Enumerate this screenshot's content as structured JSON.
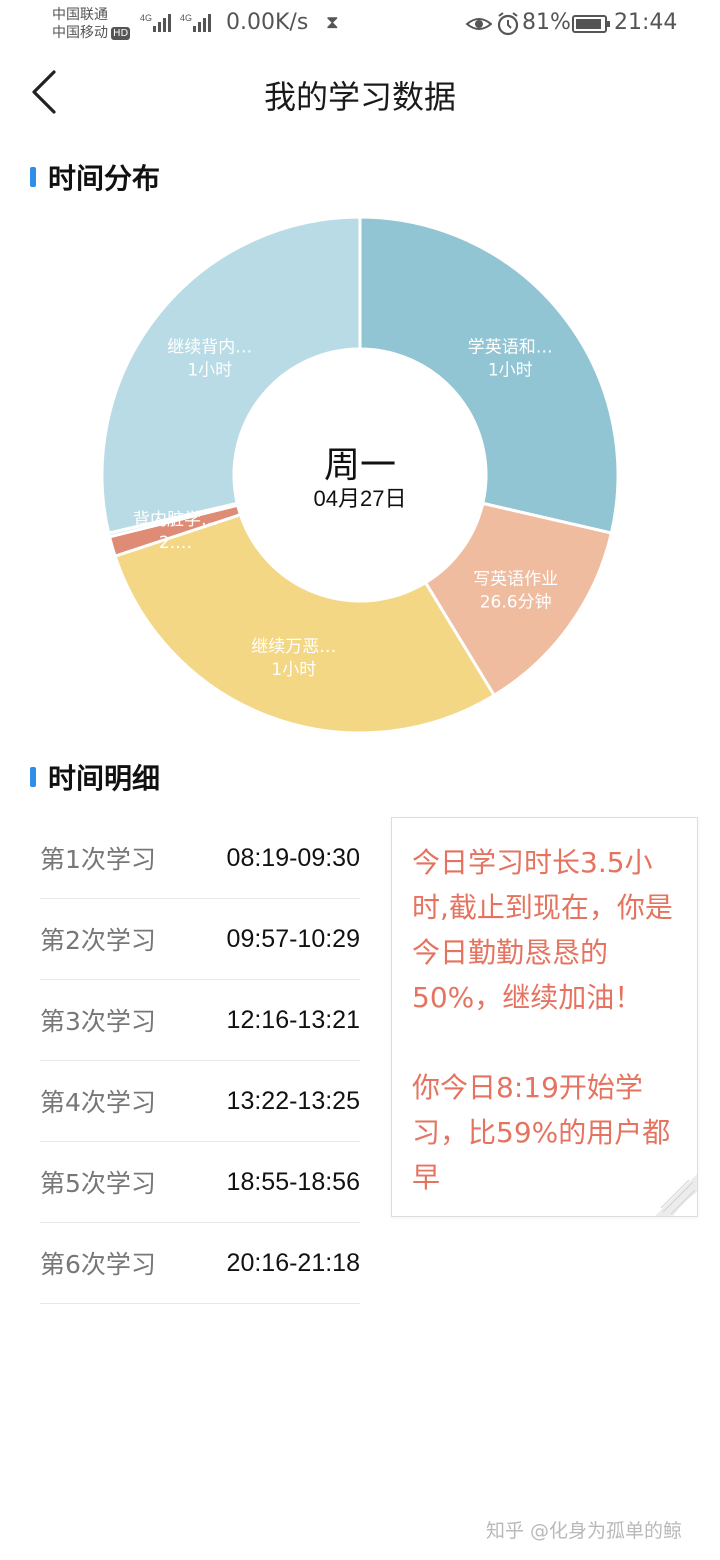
{
  "status_bar": {
    "carrier1": "中国联通",
    "carrier2": "中国移动",
    "hd": "HD",
    "net1": "4G",
    "net2": "4G",
    "net_speed": "0.00K/s",
    "battery": "81%",
    "time": "21:44"
  },
  "header": {
    "title": "我的学习数据",
    "back_icon": "chevron-left-icon"
  },
  "sections": {
    "distribution": "时间分布",
    "detail": "时间明细"
  },
  "chart_data": {
    "type": "pie",
    "style": "donut",
    "center": {
      "day": "周一",
      "date": "04月27日"
    },
    "slices": [
      {
        "label": "学英语和…",
        "value_text": "1小时",
        "minutes": 60,
        "color": "#91c5d4"
      },
      {
        "label": "写英语作业",
        "value_text": "26.6分钟",
        "minutes": 26.6,
        "color": "#efbca0"
      },
      {
        "label": "继续万恶…",
        "value_text": "1小时",
        "minutes": 60,
        "color": "#f3d784"
      },
      {
        "label": "背内脏学…",
        "value_text": "2.…",
        "minutes": 2.6,
        "color": "#df8c76"
      },
      {
        "label": "",
        "value_text": "",
        "minutes": 0.5,
        "color": "#cfe7ee"
      },
      {
        "label": "继续背内…",
        "value_text": "1小时",
        "minutes": 60,
        "color": "#b9dbe5"
      }
    ]
  },
  "sessions": [
    {
      "label": "第1次学习",
      "time": "08:19-09:30"
    },
    {
      "label": "第2次学习",
      "time": "09:57-10:29"
    },
    {
      "label": "第3次学习",
      "time": "12:16-13:21"
    },
    {
      "label": "第4次学习",
      "time": "13:22-13:25"
    },
    {
      "label": "第5次学习",
      "time": "18:55-18:56"
    },
    {
      "label": "第6次学习",
      "time": "20:16-21:18"
    }
  ],
  "note": {
    "para1": "今日学习时长3.5小时,截止到现在，你是今日勤勤恳恳的50%，继续加油！",
    "para2": "你今日8:19开始学习，比59%的用户都早"
  },
  "watermark": "知乎 @化身为孤单的鲸"
}
